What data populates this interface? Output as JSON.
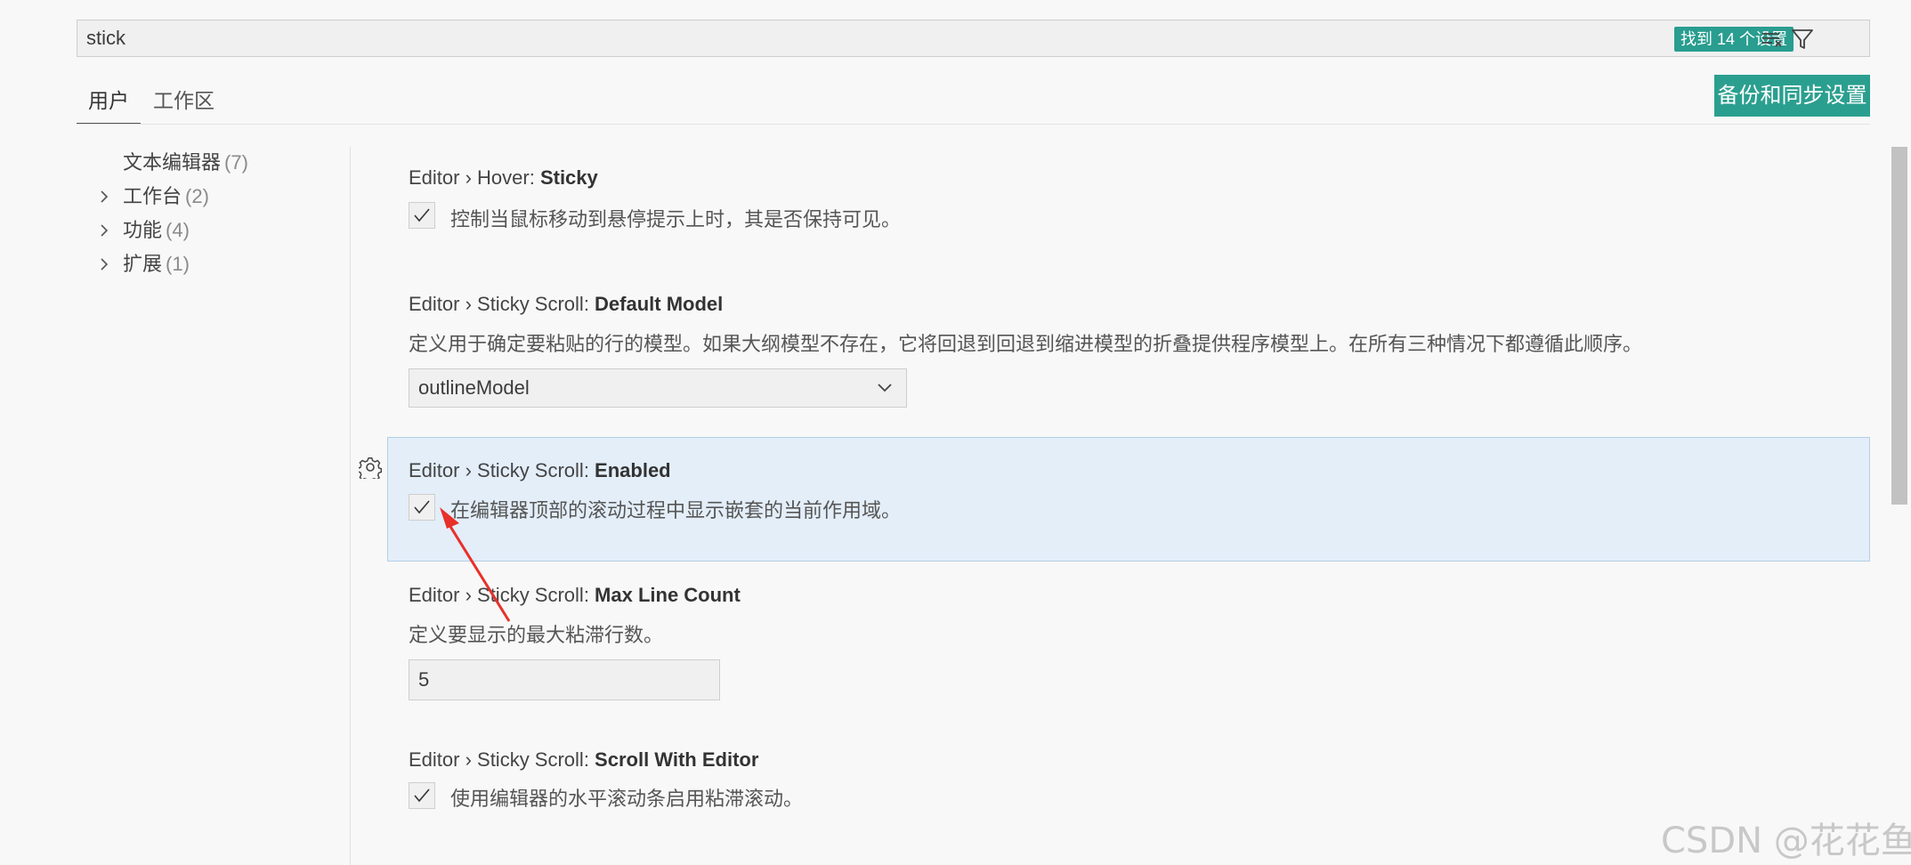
{
  "search": {
    "value": "stick",
    "result_label": "找到 14 个设置",
    "clear_icon": "clear-filter-icon",
    "filter_icon": "filter-icon"
  },
  "tabs": [
    {
      "label": "用户",
      "active": true
    },
    {
      "label": "工作区",
      "active": false
    }
  ],
  "sync_button": {
    "label": "备份和同步设置"
  },
  "toc": [
    {
      "label": "文本编辑器",
      "count": "(7)",
      "expandable": false
    },
    {
      "label": "工作台",
      "count": "(2)",
      "expandable": true
    },
    {
      "label": "功能",
      "count": "(4)",
      "expandable": true
    },
    {
      "label": "扩展",
      "count": "(1)",
      "expandable": true
    }
  ],
  "settings": [
    {
      "prefix": "Editor › Hover: ",
      "name": "Sticky",
      "type": "checkbox",
      "checked": true,
      "description": "控制当鼠标移动到悬停提示上时，其是否保持可见。"
    },
    {
      "prefix": "Editor › Sticky Scroll: ",
      "name": "Default Model",
      "type": "select",
      "description": "定义用于确定要粘贴的行的模型。如果大纲模型不存在，它将回退到回退到缩进模型的折叠提供程序模型上。在所有三种情况下都遵循此顺序。",
      "value": "outlineModel"
    },
    {
      "prefix": "Editor › Sticky Scroll: ",
      "name": "Enabled",
      "type": "checkbox",
      "checked": true,
      "focused": true,
      "description": "在编辑器顶部的滚动过程中显示嵌套的当前作用域。"
    },
    {
      "prefix": "Editor › Sticky Scroll: ",
      "name": "Max Line Count",
      "type": "number",
      "description": "定义要显示的最大粘滞行数。",
      "value": "5"
    },
    {
      "prefix": "Editor › Sticky Scroll: ",
      "name": "Scroll With Editor",
      "type": "checkbox",
      "checked": true,
      "description": "使用编辑器的水平滚动条启用粘滞滚动。"
    }
  ],
  "watermark": "CSDN @花花鱼",
  "colors": {
    "accent": "#2b9f8f",
    "focused_row": "#e3eef9",
    "annotation_arrow": "#e8302a"
  }
}
